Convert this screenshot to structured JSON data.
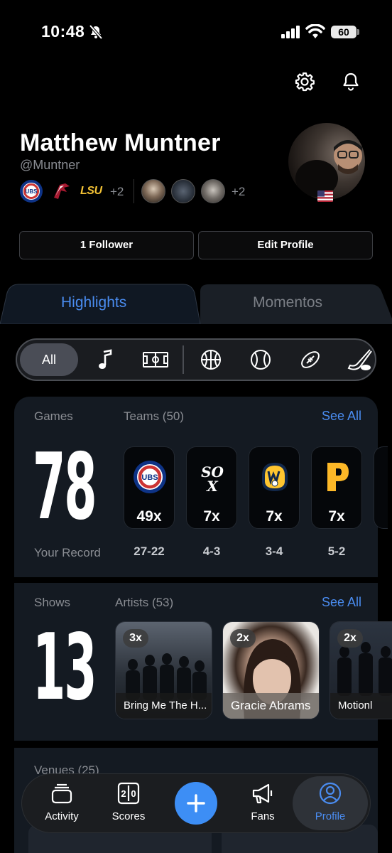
{
  "status_bar": {
    "time": "10:48",
    "battery": "60"
  },
  "profile": {
    "name": "Matthew Muntner",
    "handle": "@Muntner",
    "fav_teams_more": "+2",
    "friends_more": "+2",
    "team_logo_lsu": "LSU",
    "followers_button": "1 Follower",
    "edit_button": "Edit Profile"
  },
  "tabs": {
    "highlights": "Highlights",
    "momentos": "Momentos",
    "active": "Highlights"
  },
  "filters": {
    "all": "All",
    "icons": [
      "music-note-icon",
      "soccer-field-icon",
      "basketball-icon",
      "baseball-icon",
      "football-icon",
      "hockey-icon"
    ]
  },
  "games": {
    "label": "Games",
    "count": "78",
    "teams_label": "Teams (50)",
    "see_all": "See All",
    "record_label": "Your Record",
    "teams": [
      {
        "logo": "cubs-logo",
        "count": "49x",
        "record": "27-22"
      },
      {
        "logo": "white-sox-logo",
        "count": "7x",
        "record": "4-3"
      },
      {
        "logo": "brewers-logo",
        "count": "7x",
        "record": "3-4"
      },
      {
        "logo": "pirates-logo",
        "count": "7x",
        "record": "5-2"
      }
    ]
  },
  "shows": {
    "label": "Shows",
    "count": "13",
    "artists_label": "Artists (53)",
    "see_all": "See All",
    "artists": [
      {
        "name": "Bring Me The H...",
        "count": "3x"
      },
      {
        "name": "Gracie Abrams",
        "count": "2x"
      },
      {
        "name": "Motionl",
        "count": "2x"
      }
    ]
  },
  "venues": {
    "label": "Venues (25)"
  },
  "tab_bar": {
    "activity": "Activity",
    "scores": "Scores",
    "fans": "Fans",
    "profile": "Profile",
    "active": "Profile"
  },
  "colors": {
    "accent": "#4a8cf0",
    "fab": "#3d8ef5",
    "background": "#000000",
    "card": "#141a22"
  }
}
